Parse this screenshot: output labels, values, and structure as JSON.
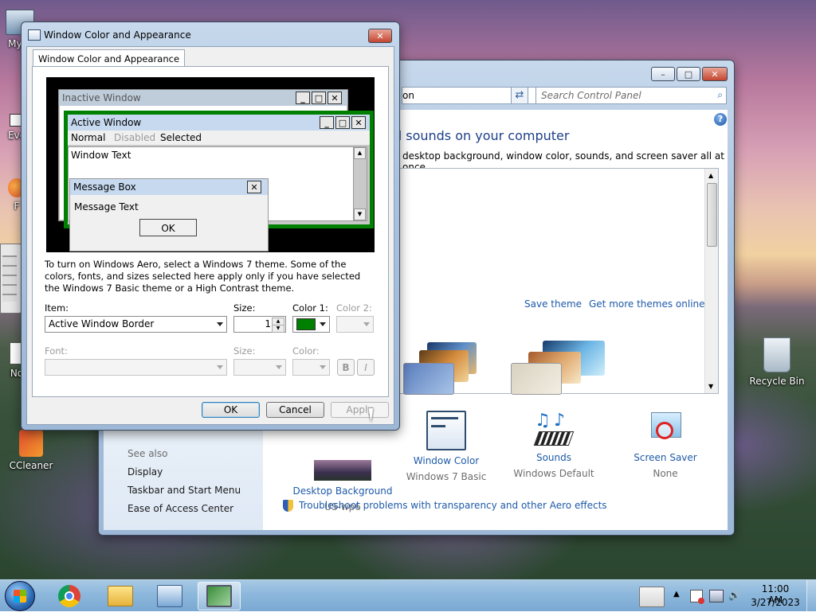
{
  "desktop": {
    "icons": [
      {
        "label": "My C"
      },
      {
        "label": "Eve"
      },
      {
        "label": "F"
      },
      {
        "label": "No"
      },
      {
        "label": "CCleaner"
      },
      {
        "label": "Recycle Bin"
      }
    ]
  },
  "control_panel": {
    "address_text": "on",
    "search_placeholder": "Search Control Panel",
    "heading": "d sounds on your computer",
    "subheading": "desktop background, window color, sounds, and screen saver all at once.",
    "save_theme": "Save theme",
    "get_more_themes": "Get more themes online",
    "see_also": "See also",
    "side_links": [
      "Display",
      "Taskbar and Start Menu",
      "Ease of Access Center"
    ],
    "bottom_items": [
      {
        "title": "Desktop Background",
        "sub": "US-wp6"
      },
      {
        "title": "Window Color",
        "sub": "Windows 7 Basic"
      },
      {
        "title": "Sounds",
        "sub": "Windows Default"
      },
      {
        "title": "Screen Saver",
        "sub": "None"
      }
    ],
    "troubleshoot": "Troubleshoot problems with transparency and other Aero effects"
  },
  "dialog": {
    "title": "Window Color and Appearance",
    "tab": "Window Color and Appearance",
    "preview": {
      "inactive_window": "Inactive Window",
      "active_window": "Active Window",
      "menu_normal": "Normal",
      "menu_disabled": "Disabled",
      "menu_selected": "Selected",
      "window_text": "Window Text",
      "message_box": "Message Box",
      "message_text": "Message Text",
      "ok": "OK"
    },
    "info_text": "To turn on Windows Aero, select a Windows 7 theme.  Some of the colors, fonts, and sizes selected here apply only if you have selected the Windows 7 Basic theme or a High Contrast theme.",
    "item_label": "Item:",
    "item_value": "Active Window Border",
    "size_label": "Size:",
    "size_value": "1",
    "color1_label": "Color 1:",
    "color1_value": "#008000",
    "color2_label": "Color 2:",
    "font_label": "Font:",
    "font_size_label": "Size:",
    "font_color_label": "Color:",
    "bold": "B",
    "italic": "I",
    "ok": "OK",
    "cancel": "Cancel",
    "apply": "Apply"
  },
  "taskbar": {
    "time": "11:00 AM",
    "date": "3/27/2023"
  },
  "colors": {
    "link": "#1e5aa8",
    "active_title": "#c6d9ef",
    "border_green": "#008000"
  }
}
